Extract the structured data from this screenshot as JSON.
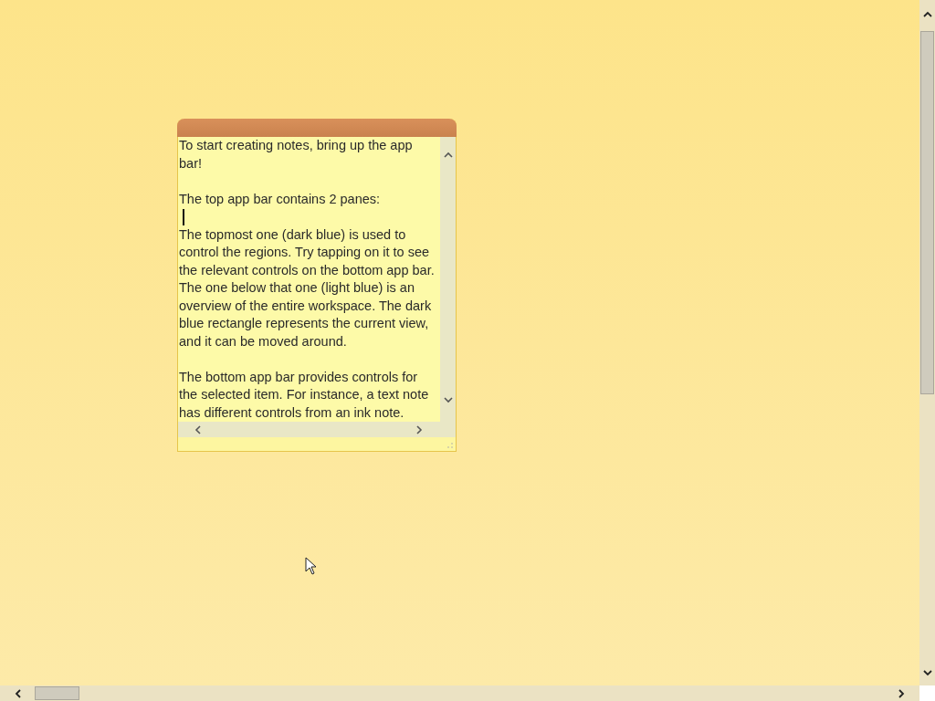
{
  "note": {
    "lines": [
      {
        "kind": "text",
        "text": "To start creating notes, bring up the app bar!"
      },
      {
        "kind": "blank"
      },
      {
        "kind": "text",
        "text": "The top app bar contains 2 panes:"
      },
      {
        "kind": "caret"
      },
      {
        "kind": "text",
        "text": "The topmost one (dark blue) is used to control the regions. Try tapping on it to see the relevant controls on the bottom app bar."
      },
      {
        "kind": "text",
        "text": "The one below that one (light blue) is an overview of the entire workspace. The dark blue rectangle represents the current view, and it can be moved around."
      },
      {
        "kind": "blank"
      },
      {
        "kind": "text",
        "text": "The bottom app bar provides controls for the selected item. For instance, a text note has different controls from an ink note."
      }
    ]
  }
}
